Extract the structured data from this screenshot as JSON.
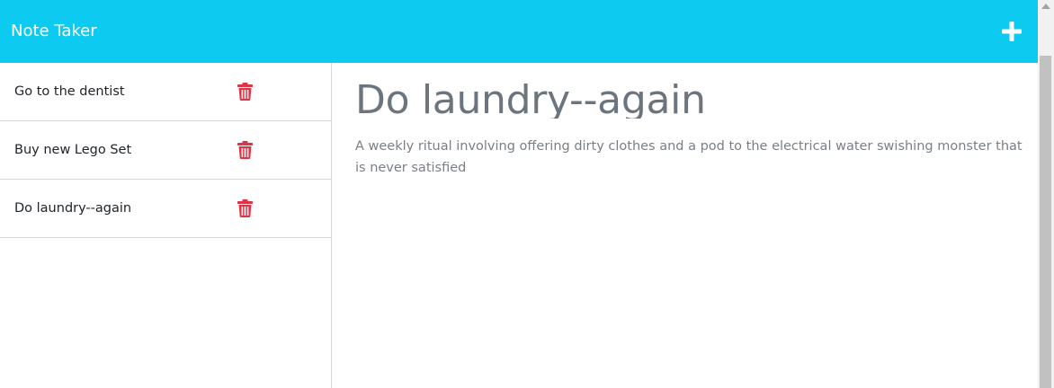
{
  "header": {
    "brand": "Note Taker",
    "add_icon": "plus-icon",
    "background_color": "#0dcaf0"
  },
  "sidebar": {
    "notes": [
      {
        "title": "Go to the dentist",
        "delete_icon": "trash-icon"
      },
      {
        "title": "Buy new Lego Set",
        "delete_icon": "trash-icon"
      },
      {
        "title": "Do laundry--again",
        "delete_icon": "trash-icon"
      }
    ],
    "delete_icon_color": "#dc3545"
  },
  "main": {
    "title": "Do laundry--again",
    "body": "A weekly ritual involving offering dirty clothes and a pod to the electrical water swishing monster that is never satisfied"
  }
}
